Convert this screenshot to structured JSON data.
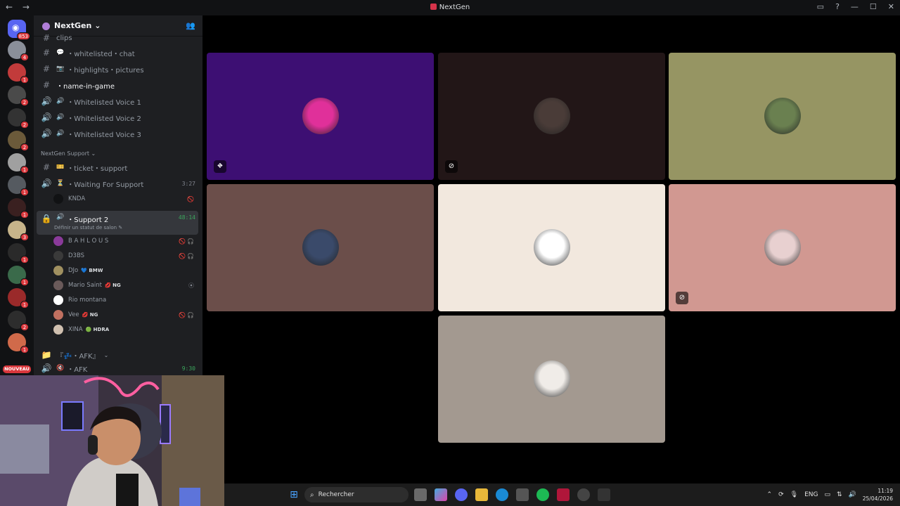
{
  "window": {
    "title": "NextGen",
    "back_icon": "←",
    "forward_icon": "→",
    "controls": [
      "screen-icon",
      "help-icon",
      "minimize-icon",
      "maximize-icon",
      "close-icon"
    ]
  },
  "servers": {
    "home_badge": "853",
    "items": [
      {
        "badge": "4",
        "color": "#8a8f99"
      },
      {
        "badge": "1",
        "color": "#c23b3b"
      },
      {
        "badge": "2",
        "color": "#4a4a4a"
      },
      {
        "badge": "2",
        "color": "#333333"
      },
      {
        "badge": "2",
        "color": "#6b5a3a"
      },
      {
        "badge": "1",
        "color": "#a0a0a0"
      },
      {
        "badge": "1",
        "color": "#555a60"
      },
      {
        "badge": "1",
        "color": "#3a2020"
      },
      {
        "badge": "3",
        "color": "#c7b48a"
      },
      {
        "badge": "1",
        "color": "#2a2a2a"
      },
      {
        "badge": "1",
        "color": "#3a6a4a"
      },
      {
        "badge": "1",
        "color": "#9a2a2a"
      },
      {
        "badge": "2",
        "color": "#2d2d2d"
      },
      {
        "badge": "1",
        "color": "#d06a4a"
      }
    ],
    "new_label": "NOUVEAU"
  },
  "guild": {
    "name": "NextGen",
    "chevron": "⌄"
  },
  "channels": {
    "top_cut_label": "clips",
    "items": [
      {
        "type": "text",
        "emoji": "💬",
        "name": "・whitelisted・chat"
      },
      {
        "type": "text",
        "emoji": "📷",
        "name": "・highlights・pictures"
      },
      {
        "type": "text",
        "emoji": "",
        "name": "・name-in-game"
      },
      {
        "type": "voice",
        "emoji": "🔊",
        "name": "・Whitelisted Voice 1"
      },
      {
        "type": "voice",
        "emoji": "🔊",
        "name": "・Whitelisted Voice 2"
      },
      {
        "type": "voice",
        "emoji": "🔊",
        "name": "・Whitelisted Voice 3"
      }
    ],
    "support_category": "NextGen Support",
    "ticket": {
      "emoji": "🎫",
      "name": "・ticket・support"
    },
    "waiting": {
      "emoji": "⏳",
      "name": "・Waiting For Support",
      "time": "3:27"
    },
    "waiting_user": {
      "name": "KNDA",
      "status": "🚫"
    },
    "support2": {
      "emoji": "🔊",
      "name": "・Support 2",
      "time": "48:14",
      "status_hint": "Définir un statut de salon"
    },
    "voice_users": [
      {
        "name": "B A H L O U S",
        "tag": "",
        "status": "🚫🎧",
        "color": "#8a3a9a"
      },
      {
        "name": "D3BS",
        "tag": "",
        "status": "🚫🎧",
        "color": "#3a3a3a"
      },
      {
        "name": "DJo",
        "tag": "💙 BMW",
        "status": "",
        "color": "#a09060"
      },
      {
        "name": "Mario Saint",
        "tag": "💋 NG",
        "status": "⦿",
        "color": "#6a5a5a"
      },
      {
        "name": "Rio montana",
        "tag": "",
        "status": "",
        "color": "#ffffff"
      },
      {
        "name": "Vee",
        "tag": "💋 NG",
        "status": "🚫🎧",
        "color": "#c07060"
      },
      {
        "name": "XINA",
        "tag": "🟢 HDRA",
        "status": "",
        "color": "#d0c0b0"
      }
    ],
    "afk_category": "『💤・AFK』",
    "afk": {
      "emoji": "🔇",
      "name": "・AFK",
      "time": "9:30"
    }
  },
  "tiles": [
    {
      "bg": "#3d0f73",
      "avatar": "#e0309a",
      "icon": "⛖"
    },
    {
      "bg": "#221617",
      "avatar": "#4a3c38",
      "icon": "⊘"
    },
    {
      "bg": "#969563",
      "avatar": "#6a8050",
      "icon": ""
    },
    {
      "bg": "#6b4e4a",
      "avatar": "#3a4a6a",
      "icon": ""
    },
    {
      "bg": "#f2e8de",
      "avatar": "#ffffff",
      "icon": ""
    },
    {
      "bg": "#d19891",
      "avatar": "#e8d0d0",
      "icon": "⊘"
    },
    {
      "bg": "#a39990",
      "avatar": "#f0ece8",
      "icon": ""
    }
  ],
  "taskbar": {
    "search_label": "Rechercher",
    "lang": "ENG",
    "time": "11:19",
    "date": "25/04/2026"
  }
}
